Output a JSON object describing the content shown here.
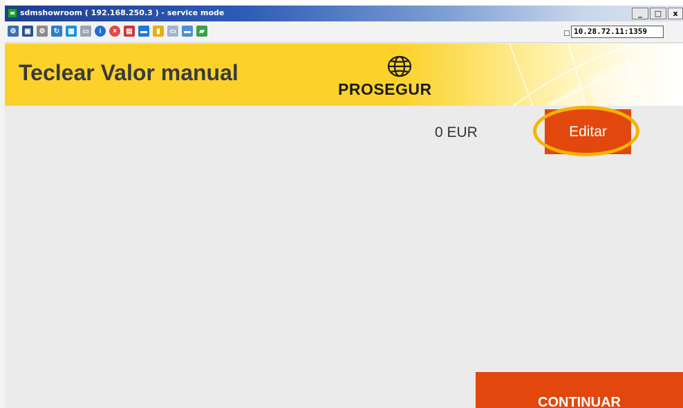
{
  "window": {
    "title": "sdmshowroom ( 192.168.250.3 ) - service mode",
    "minimize_label": "_",
    "maximize_label": "□",
    "close_label": "x",
    "address": "10.28.72.11:1359"
  },
  "toolbar": {
    "icons": [
      {
        "name": "network-icon",
        "color": "#3a6fb0"
      },
      {
        "name": "fullscreen-icon",
        "color": "#2b4f8f"
      },
      {
        "name": "settings-icon",
        "color": "#8a8a8a"
      },
      {
        "name": "refresh-icon",
        "color": "#2a7fd0"
      },
      {
        "name": "windows-icon",
        "color": "#1e90e0"
      },
      {
        "name": "keyboard-icon",
        "color": "#9aa6b2"
      },
      {
        "name": "info-icon",
        "color": "#1d6fd1"
      },
      {
        "name": "stop-icon",
        "color": "#e04848"
      },
      {
        "name": "document-icon",
        "color": "#c83a3a"
      },
      {
        "name": "monitor-icon",
        "color": "#1f7ad6"
      },
      {
        "name": "folder-icon",
        "color": "#e3b017"
      },
      {
        "name": "window-icon",
        "color": "#9fb6cf"
      },
      {
        "name": "display-icon",
        "color": "#4e8fd6"
      },
      {
        "name": "chat-icon",
        "color": "#3aa04a"
      }
    ]
  },
  "header": {
    "title": "Teclear Valor manual",
    "logo_text": "PROSEGUR"
  },
  "main": {
    "amount": "0 EUR",
    "edit_label": "Editar",
    "continue_label": "CONTINUAR"
  },
  "colors": {
    "accent": "#e2470e",
    "brand_yellow": "#fcd22a",
    "highlight": "#f6b400"
  }
}
